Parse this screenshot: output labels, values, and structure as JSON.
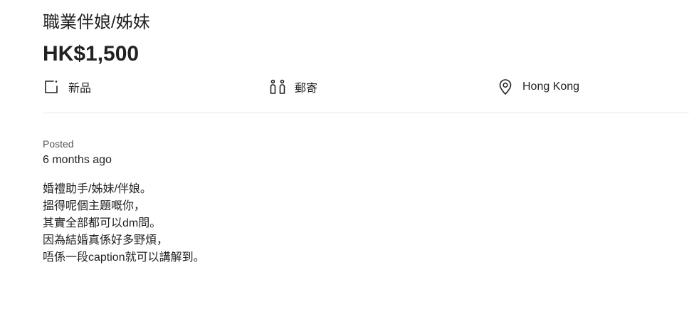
{
  "listing": {
    "title": "職業伴娘/姊妹",
    "price": "HK$1,500",
    "attributes": {
      "condition": {
        "icon": "condition-tag-icon",
        "label": "新品"
      },
      "delivery": {
        "icon": "delivery-meetup-icon",
        "label": "郵寄"
      },
      "location": {
        "icon": "location-pin-icon",
        "label": "Hong Kong"
      }
    },
    "posted": {
      "label": "Posted",
      "value": "6 months ago"
    },
    "description": [
      "婚禮助手/姊妹/伴娘。",
      "搵得呢個主題嘅你，",
      "其實全部都可以dm問。",
      "因為結婚真係好多野煩，",
      "唔係一段caption就可以講解到。"
    ]
  }
}
